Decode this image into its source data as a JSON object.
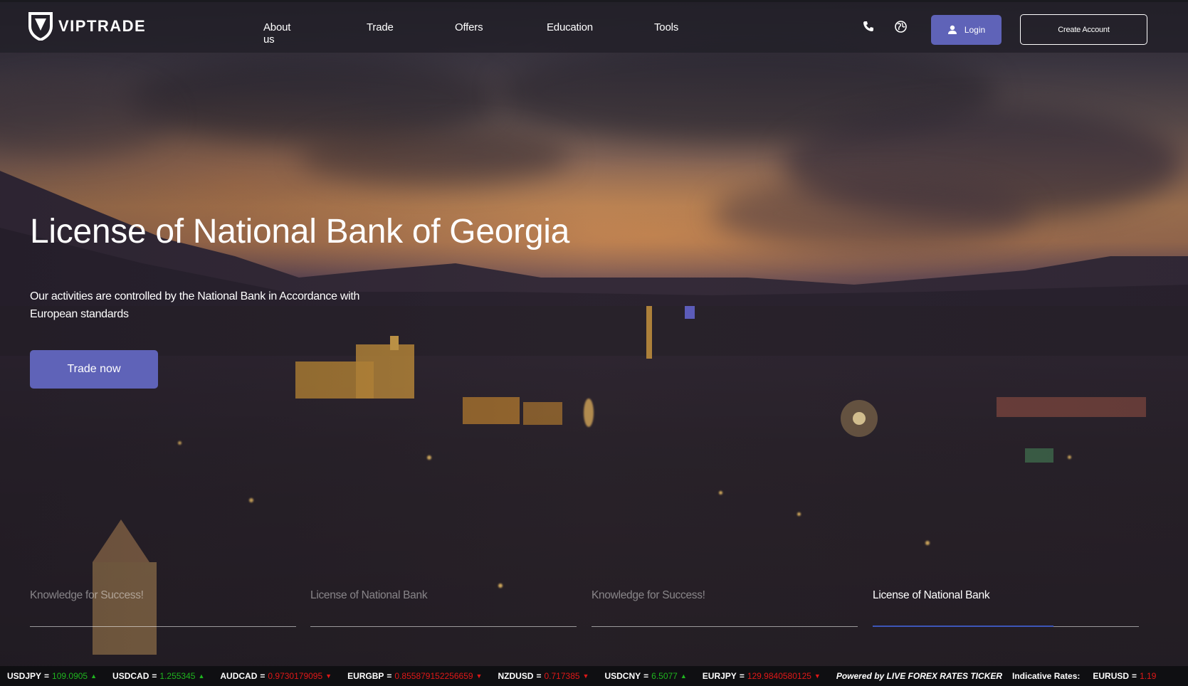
{
  "brand": {
    "name": "VIPTRADE",
    "logo_icon": "viptrade-shield-logo"
  },
  "nav": {
    "links": [
      "About us",
      "Trade",
      "Offers",
      "Education",
      "Tools"
    ],
    "phone_icon": "phone-icon",
    "globe_icon": "globe-icon",
    "login_label": "Login",
    "login_icon": "user-icon",
    "create_account_label": "Create Account"
  },
  "hero": {
    "title": "License of National Bank of Georgia",
    "subtitle": "Our activities are controlled by the National Bank in Accordance with European standards",
    "cta_label": "Trade now"
  },
  "slider": {
    "tabs": [
      {
        "label": "Knowledge for Success!",
        "active": false
      },
      {
        "label": "License of National Bank",
        "active": false
      },
      {
        "label": "Knowledge for Success!",
        "active": false
      },
      {
        "label": "License of National Bank",
        "active": true
      }
    ]
  },
  "ticker": {
    "items": [
      {
        "pair": "USDJPY",
        "value": "109.0905",
        "dir": "up"
      },
      {
        "pair": "USDCAD",
        "value": "1.255345",
        "dir": "up"
      },
      {
        "pair": "AUDCAD",
        "value": "0.9730179095",
        "dir": "down"
      },
      {
        "pair": "EURGBP",
        "value": "0.855879152256659",
        "dir": "down"
      },
      {
        "pair": "NZDUSD",
        "value": "0.717385",
        "dir": "down"
      },
      {
        "pair": "USDCNY",
        "value": "6.5077",
        "dir": "up"
      },
      {
        "pair": "EURJPY",
        "value": "129.9840580125",
        "dir": "down"
      }
    ],
    "powered_by": "Powered by LIVE FOREX RATES TICKER",
    "indicative": "Indicative Rates:",
    "last_pair": "EURUSD",
    "last_value": "1.19",
    "separator": "=",
    "colors": {
      "up": "#1fb51f",
      "down": "#e01818",
      "accent": "#5f63b8"
    }
  }
}
